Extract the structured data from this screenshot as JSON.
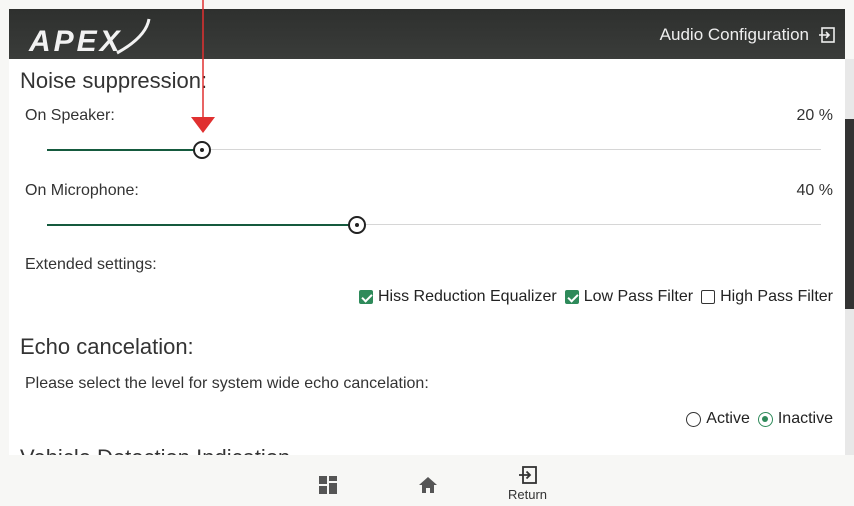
{
  "header": {
    "logo_text": "APEX",
    "title": "Audio Configuration",
    "exit_icon": "exit-icon"
  },
  "noise_suppression": {
    "title": "Noise suppression:",
    "speaker": {
      "label": "On Speaker:",
      "value_text": "20 %",
      "value": 20
    },
    "microphone": {
      "label": "On Microphone:",
      "value_text": "40 %",
      "value": 40
    },
    "extended": {
      "label": "Extended settings:",
      "options": [
        {
          "label": "Hiss Reduction Equalizer",
          "checked": true
        },
        {
          "label": "Low Pass Filter",
          "checked": true
        },
        {
          "label": "High Pass Filter",
          "checked": false
        }
      ]
    }
  },
  "echo_cancelation": {
    "title": "Echo cancelation:",
    "description": "Please select the level for system wide echo cancelation:",
    "options": [
      {
        "label": "Active",
        "selected": false
      },
      {
        "label": "Inactive",
        "selected": true
      }
    ]
  },
  "next_section_partial": "Vehicle Detection Indication",
  "bottom_nav": {
    "grid_icon": "grid-icon",
    "home_icon": "home-icon",
    "return_label": "Return"
  },
  "colors": {
    "header_bg": "#333533",
    "accent_green": "#2e8a5a",
    "slider_fill": "#155a3e",
    "annotation_red": "#e03030"
  }
}
